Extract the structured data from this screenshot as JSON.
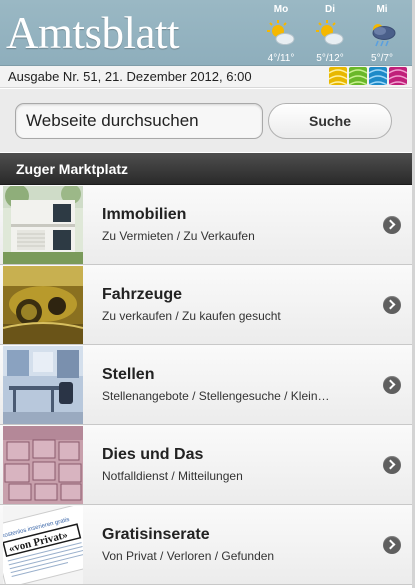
{
  "header": {
    "logo": "Amtsblatt",
    "weather": [
      {
        "day": "Mo",
        "temp": "4°/11°",
        "icon": "sun-cloud-icon"
      },
      {
        "day": "Di",
        "temp": "5°/12°",
        "icon": "sun-cloud-icon"
      },
      {
        "day": "Mi",
        "temp": "5°/7°",
        "icon": "cloud-rain-icon"
      }
    ]
  },
  "issue": {
    "text": "Ausgabe Nr. 51, 21. Dezember 2012, 6:00",
    "swatch_colors": [
      "#e8b800",
      "#6ab82a",
      "#1e8ac8",
      "#c0207a"
    ]
  },
  "search": {
    "placeholder": "Webseite durchsuchen",
    "button": "Suche"
  },
  "section": {
    "title": "Zuger Marktplatz"
  },
  "items": [
    {
      "title": "Immobilien",
      "subtitle": "Zu Vermieten / Zu Verkaufen",
      "image": "house-photo"
    },
    {
      "title": "Fahrzeuge",
      "subtitle": "Zu verkaufen / Zu kaufen gesucht",
      "image": "car-interior-photo"
    },
    {
      "title": "Stellen",
      "subtitle": "Stellenangebote / Stellengesuche / Klein…",
      "image": "office-photo"
    },
    {
      "title": "Dies und Das",
      "subtitle": "Notfalldienst / Mitteilungen",
      "image": "boxes-photo"
    },
    {
      "title": "Gratisinserate",
      "subtitle": "Von Privat / Verloren / Gefunden",
      "image": "newspaper-photo"
    }
  ],
  "thumb_texts": {
    "gratis_small": "kostenlos inserieren gratis",
    "von_privat": "«von Privat»"
  },
  "colors": {
    "header_bg": "#9ab8c4",
    "section_bg": "#2a2a2a",
    "chevron": "#5f5f5f"
  }
}
